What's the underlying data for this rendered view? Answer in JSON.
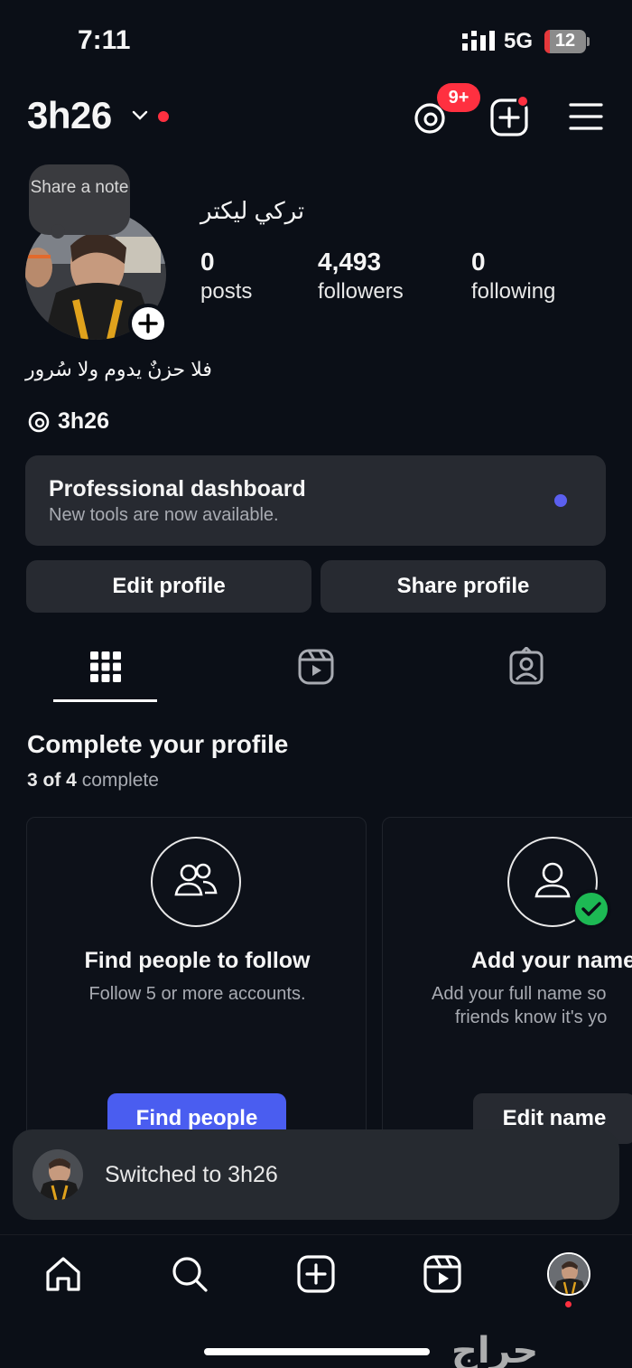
{
  "status_bar": {
    "time": "7:11",
    "network": "5G",
    "battery": "12",
    "battery_level": 0.12
  },
  "header": {
    "username": "3h26",
    "threads_badge": "9+"
  },
  "profile": {
    "note_label": "Share a note",
    "display_name": "تركي ليكتر",
    "stats": [
      {
        "value": "0",
        "label": "posts"
      },
      {
        "value": "4,493",
        "label": "followers"
      },
      {
        "value": "0",
        "label": "following"
      }
    ],
    "bio": "فلا حزنٌ يدوم ولا سُرور",
    "threads_handle": "3h26"
  },
  "dashboard": {
    "title": "Professional dashboard",
    "subtitle": "New tools are now available."
  },
  "actions": {
    "edit_label": "Edit profile",
    "share_label": "Share profile"
  },
  "complete_profile": {
    "title": "Complete your profile",
    "progress_count": "3 of 4",
    "progress_word": "complete",
    "cards": [
      {
        "title": "Find people to follow",
        "subtitle": "Follow 5 or more accounts.",
        "button": "Find people"
      },
      {
        "title": "Add your name",
        "subtitle_line1": "Add your full name so",
        "subtitle_line2": "friends know it's yo",
        "button": "Edit name"
      }
    ]
  },
  "toast": {
    "text": "Switched to 3h26"
  },
  "colors": {
    "background": "#0b0f17",
    "accent": "#4a5df0",
    "notification": "#ff3040",
    "success": "#1db954"
  },
  "icons": [
    "threads-icon",
    "new-post-icon",
    "menu-icon",
    "grid-icon",
    "reels-icon",
    "tagged-icon",
    "people-icon",
    "user-icon",
    "home-icon",
    "search-icon",
    "create-icon"
  ],
  "watermark": "حراج"
}
